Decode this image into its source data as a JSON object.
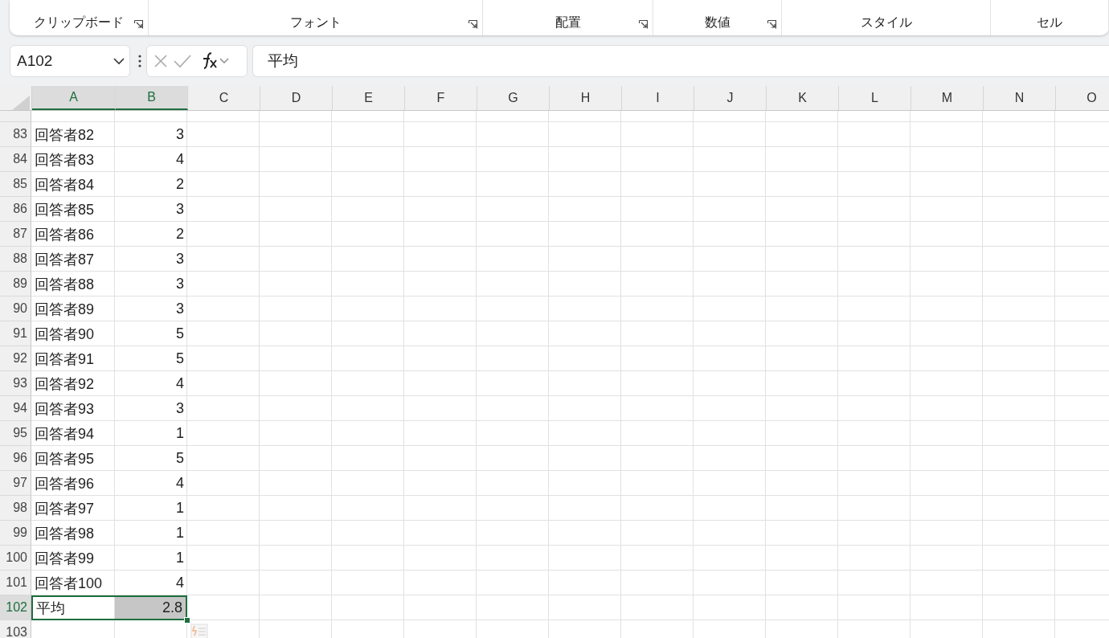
{
  "ribbon": {
    "groups": [
      {
        "label": "クリップボード",
        "launcher": true
      },
      {
        "label": "フォント",
        "launcher": true
      },
      {
        "label": "配置",
        "launcher": true
      },
      {
        "label": "数値",
        "launcher": true
      },
      {
        "label": "スタイル",
        "launcher": false
      },
      {
        "label": "セル",
        "launcher": false
      }
    ]
  },
  "formula_bar": {
    "name_box": "A102",
    "formula": "平均"
  },
  "sheet": {
    "columns": [
      {
        "label": "A",
        "selected": true
      },
      {
        "label": "B",
        "selected": true
      },
      {
        "label": "C",
        "selected": false
      },
      {
        "label": "D",
        "selected": false
      },
      {
        "label": "E",
        "selected": false
      },
      {
        "label": "F",
        "selected": false
      },
      {
        "label": "G",
        "selected": false
      },
      {
        "label": "H",
        "selected": false
      },
      {
        "label": "I",
        "selected": false
      },
      {
        "label": "J",
        "selected": false
      },
      {
        "label": "K",
        "selected": false
      },
      {
        "label": "L",
        "selected": false
      },
      {
        "label": "M",
        "selected": false
      },
      {
        "label": "N",
        "selected": false
      },
      {
        "label": "O",
        "selected": false
      }
    ],
    "rows": [
      {
        "number": "83",
        "selected": false,
        "cells": [
          "回答者82",
          "3"
        ]
      },
      {
        "number": "84",
        "selected": false,
        "cells": [
          "回答者83",
          "4"
        ]
      },
      {
        "number": "85",
        "selected": false,
        "cells": [
          "回答者84",
          "2"
        ]
      },
      {
        "number": "86",
        "selected": false,
        "cells": [
          "回答者85",
          "3"
        ]
      },
      {
        "number": "87",
        "selected": false,
        "cells": [
          "回答者86",
          "2"
        ]
      },
      {
        "number": "88",
        "selected": false,
        "cells": [
          "回答者87",
          "3"
        ]
      },
      {
        "number": "89",
        "selected": false,
        "cells": [
          "回答者88",
          "3"
        ]
      },
      {
        "number": "90",
        "selected": false,
        "cells": [
          "回答者89",
          "3"
        ]
      },
      {
        "number": "91",
        "selected": false,
        "cells": [
          "回答者90",
          "5"
        ]
      },
      {
        "number": "92",
        "selected": false,
        "cells": [
          "回答者91",
          "5"
        ]
      },
      {
        "number": "93",
        "selected": false,
        "cells": [
          "回答者92",
          "4"
        ]
      },
      {
        "number": "94",
        "selected": false,
        "cells": [
          "回答者93",
          "3"
        ]
      },
      {
        "number": "95",
        "selected": false,
        "cells": [
          "回答者94",
          "1"
        ]
      },
      {
        "number": "96",
        "selected": false,
        "cells": [
          "回答者95",
          "5"
        ]
      },
      {
        "number": "97",
        "selected": false,
        "cells": [
          "回答者96",
          "4"
        ]
      },
      {
        "number": "98",
        "selected": false,
        "cells": [
          "回答者97",
          "1"
        ]
      },
      {
        "number": "99",
        "selected": false,
        "cells": [
          "回答者98",
          "1"
        ]
      },
      {
        "number": "100",
        "selected": false,
        "cells": [
          "回答者99",
          "1"
        ]
      },
      {
        "number": "101",
        "selected": false,
        "cells": [
          "回答者100",
          "4"
        ]
      },
      {
        "number": "102",
        "selected": true,
        "cells": [
          "平均",
          "2.8"
        ]
      },
      {
        "number": "103",
        "selected": false,
        "cells": [
          "",
          ""
        ]
      }
    ]
  }
}
